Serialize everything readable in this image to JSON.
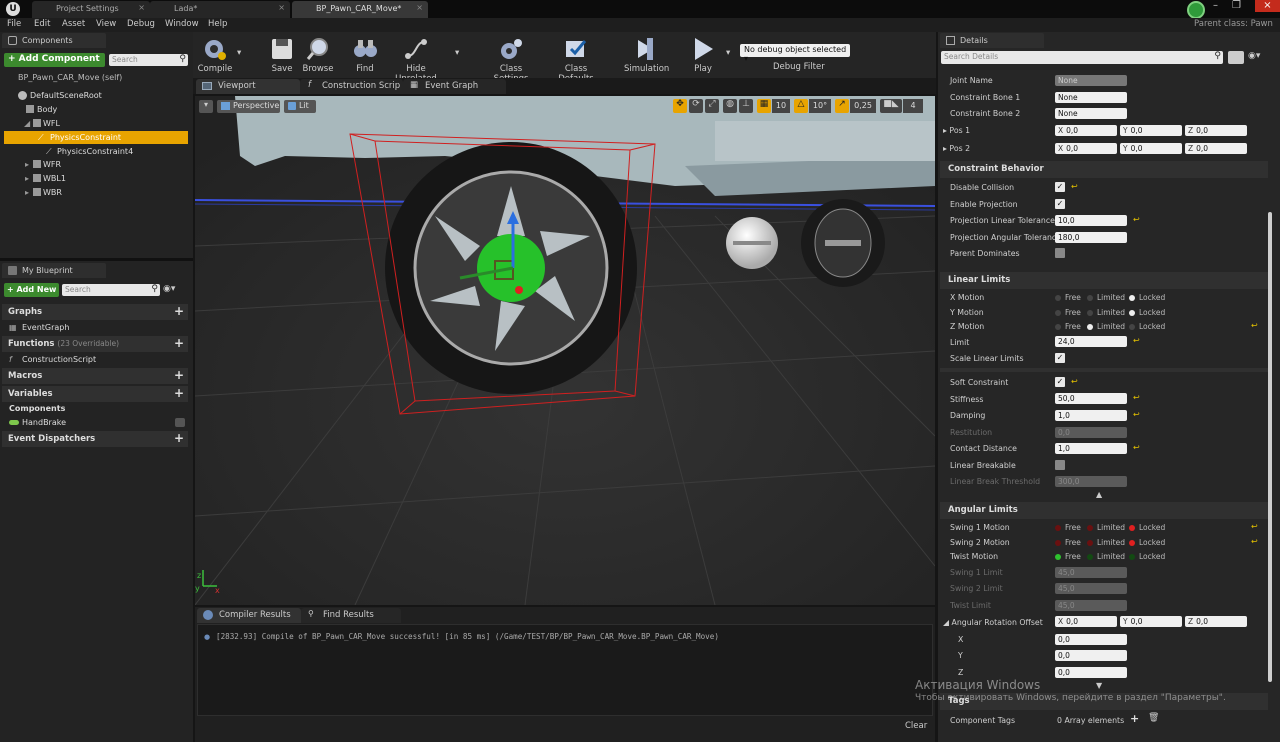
{
  "window": {
    "tabs": [
      {
        "label": "Project Settings"
      },
      {
        "label": "Lada*"
      },
      {
        "label": "BP_Pawn_CAR_Move*"
      }
    ],
    "parent_class": "Parent class: Pawn"
  },
  "menu": [
    "File",
    "Edit",
    "Asset",
    "View",
    "Debug",
    "Window",
    "Help"
  ],
  "components_panel": {
    "title": "Components",
    "add_button": "+ Add Component",
    "search_placeholder": "Search",
    "self_label": "BP_Pawn_CAR_Move (self)",
    "tree": [
      {
        "label": "DefaultSceneRoot"
      },
      {
        "label": "Body"
      },
      {
        "label": "WFL"
      },
      {
        "label": "PhysicsConstraint"
      },
      {
        "label": "PhysicsConstraint4"
      },
      {
        "label": "WFR"
      },
      {
        "label": "WBL1"
      },
      {
        "label": "WBR"
      }
    ]
  },
  "my_blueprint": {
    "title": "My Blueprint",
    "add_button": "+ Add New",
    "search_placeholder": "Search",
    "sections": {
      "graphs": "Graphs",
      "event_graph": "EventGraph",
      "functions": "Functions",
      "functions_note": "(23 Overridable)",
      "construction_script": "ConstructionScript",
      "macros": "Macros",
      "variables": "Variables",
      "components": "Components",
      "handbrake": "HandBrake",
      "event_dispatchers": "Event Dispatchers"
    }
  },
  "toolbar": {
    "compile": "Compile",
    "save": "Save",
    "browse": "Browse",
    "find": "Find",
    "hide_unrelated": "Hide Unrelated",
    "class_settings": "Class Settings",
    "class_defaults": "Class Defaults",
    "simulation": "Simulation",
    "play": "Play",
    "debug_select": "No debug object selected",
    "debug_filter": "Debug Filter"
  },
  "editor_tabs": {
    "viewport": "Viewport",
    "construction_script": "Construction Scrip",
    "event_graph": "Event Graph"
  },
  "viewport": {
    "perspective": "Perspective",
    "lit": "Lit",
    "grid_snap": "10",
    "rot_snap": "10°",
    "scale_snap": "0,25",
    "cam_speed": "4"
  },
  "bottom_panel": {
    "compiler_results": "Compiler Results",
    "find_results": "Find Results",
    "log_line": "[2832.93] Compile of BP_Pawn_CAR_Move successful! [in 85 ms] (/Game/TEST/BP/BP_Pawn_CAR_Move.BP_Pawn_CAR_Move)",
    "clear": "Clear"
  },
  "details": {
    "title": "Details",
    "search_placeholder": "Search Details",
    "joint_name": {
      "label": "Joint Name",
      "value": "None"
    },
    "bone1": {
      "label": "Constraint Bone 1",
      "value": "None"
    },
    "bone2": {
      "label": "Constraint Bone 2",
      "value": "None"
    },
    "pos1": {
      "label": "Pos 1",
      "x": "0,0",
      "y": "0,0",
      "z": "0,0"
    },
    "pos2": {
      "label": "Pos 2",
      "x": "0,0",
      "y": "0,0",
      "z": "0,0"
    },
    "constraint_behavior": "Constraint Behavior",
    "disable_collision": "Disable Collision",
    "enable_projection": "Enable Projection",
    "proj_linear": {
      "label": "Projection Linear Tolerance",
      "value": "10,0"
    },
    "proj_angular": {
      "label": "Projection Angular Tolerance",
      "value": "180,0"
    },
    "parent_dominates": "Parent Dominates",
    "linear_limits": "Linear Limits",
    "x_motion": "X Motion",
    "y_motion": "Y Motion",
    "z_motion": "Z Motion",
    "opt_free": "Free",
    "opt_limited": "Limited",
    "opt_locked": "Locked",
    "limit": {
      "label": "Limit",
      "value": "24,0"
    },
    "scale_linear_limits": "Scale Linear Limits",
    "soft_constraint": "Soft Constraint",
    "stiffness": {
      "label": "Stiffness",
      "value": "50,0"
    },
    "damping": {
      "label": "Damping",
      "value": "1,0"
    },
    "restitution": {
      "label": "Restitution",
      "value": "0,0"
    },
    "contact_distance": {
      "label": "Contact Distance",
      "value": "1,0"
    },
    "linear_breakable": "Linear Breakable",
    "linear_break_threshold": {
      "label": "Linear Break Threshold",
      "value": "300,0"
    },
    "angular_limits": "Angular Limits",
    "swing1_motion": "Swing 1 Motion",
    "swing2_motion": "Swing 2 Motion",
    "twist_motion": "Twist Motion",
    "swing1_limit": {
      "label": "Swing 1 Limit",
      "value": "45,0"
    },
    "swing2_limit": {
      "label": "Swing 2 Limit",
      "value": "45,0"
    },
    "twist_limit": {
      "label": "Twist Limit",
      "value": "45,0"
    },
    "angular_offset": {
      "label": "Angular Rotation Offset",
      "x": "0,0",
      "y": "0,0",
      "z": "0,0"
    },
    "ax_x": {
      "label": "X",
      "value": "0,0"
    },
    "ax_y": {
      "label": "Y",
      "value": "0,0"
    },
    "ax_z": {
      "label": "Z",
      "value": "0,0"
    },
    "tags": "Tags",
    "component_tags": {
      "label": "Component Tags",
      "value": "0 Array elements"
    }
  },
  "watermark": {
    "line1": "Активация Windows",
    "line2": "Чтобы активировать Windows, перейдите в раздел \"Параметры\"."
  },
  "colors": {
    "selection": "#e8a400",
    "accent_green": "#3a9a2a",
    "revert_yellow": "#e5c200"
  }
}
